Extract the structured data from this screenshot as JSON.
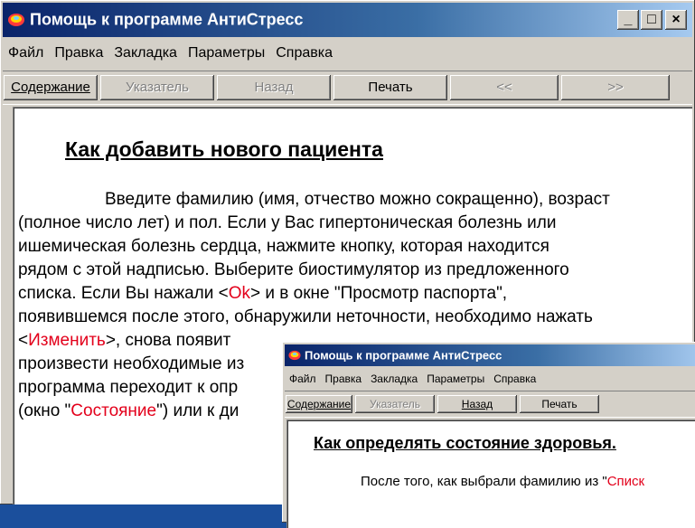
{
  "window1": {
    "title": "Помощь к программе АнтиСтресс",
    "controls": [
      "_",
      "□",
      "×"
    ],
    "menu": [
      "Файл",
      "Правка",
      "Закладка",
      "Параметры",
      "Справка"
    ],
    "toolbar": {
      "contents": "Содержание",
      "index": "Указатель",
      "back": "Назад",
      "print": "Печать",
      "prev": "<<",
      "next": ">>"
    },
    "heading": "Как добавить нового пациента",
    "lines": [
      "Введите фамилию (имя, отчество можно сокращенно), возраст",
      "(полное число лет) и пол. Если у Вас гипертоническая болезнь или",
      "ишемическая болезнь сердца, нажмите кнопку, которая находится",
      "рядом с этой надписью. Выберите биостимулятор из предложенного",
      "списка. Если Вы нажали <",
      "Ok",
      "> и в окне \"Просмотр паспорта\",",
      "появившемся после этого, обнаружили неточности, необходимо нажать",
      " <",
      "Изменить",
      ">, снова появит",
      "произвести необходимые из",
      "программа переходит к опр",
      "(окно \"",
      "Состояние",
      "\") или к ди"
    ]
  },
  "window2": {
    "title": "Помощь к программе АнтиСтресс",
    "menu": [
      "Файл",
      "Правка",
      "Закладка",
      "Параметры",
      "Справка"
    ],
    "toolbar": {
      "contents": "Содержание",
      "index": "Указатель",
      "back": "Назад",
      "print": "Печать"
    },
    "heading": "Как определять состояние здоровья.",
    "line_prefix": "После того, как выбрали фамилию из \"",
    "line_red": "Списк"
  },
  "colors": {
    "desktop": "#1b4f9c",
    "title_start": "#0a246a",
    "title_end": "#a6caf0",
    "link_red": "#e3001b"
  },
  "icons": {
    "app": "antistress-app-icon"
  }
}
